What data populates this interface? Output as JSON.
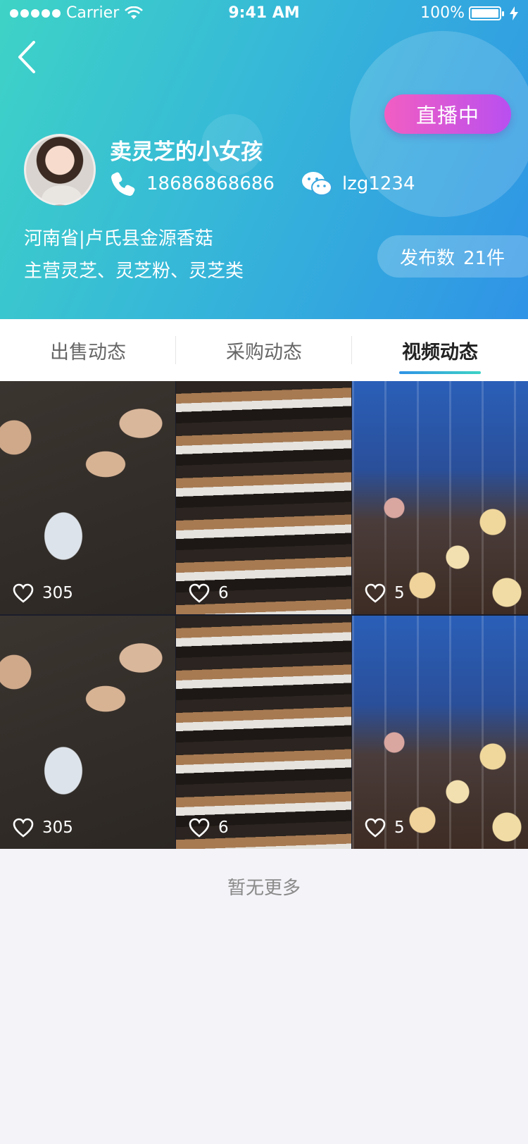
{
  "status_bar": {
    "carrier": "Carrier",
    "time": "9:41 AM",
    "battery": "100%"
  },
  "header": {
    "live_label": "直播中",
    "name": "卖灵芝的小女孩",
    "phone": "18686868686",
    "wechat": "lzg1234",
    "address": "河南省|卢氏县金源香菇",
    "business": "主营灵芝、灵芝粉、灵芝类",
    "publish_label": "发布数",
    "publish_count": "21件"
  },
  "tabs": [
    {
      "label": "出售动态",
      "active": false
    },
    {
      "label": "采购动态",
      "active": false
    },
    {
      "label": "视频动态",
      "active": true
    }
  ],
  "videos": [
    {
      "likes": "305"
    },
    {
      "likes": "6"
    },
    {
      "likes": "5"
    },
    {
      "likes": "305"
    },
    {
      "likes": "6"
    },
    {
      "likes": "5"
    }
  ],
  "footer": {
    "no_more": "暂无更多"
  },
  "colors": {
    "header_start": "#3ed3c6",
    "header_end": "#2f93e6",
    "live_start": "#f25ec2",
    "live_end": "#b94ff0"
  }
}
